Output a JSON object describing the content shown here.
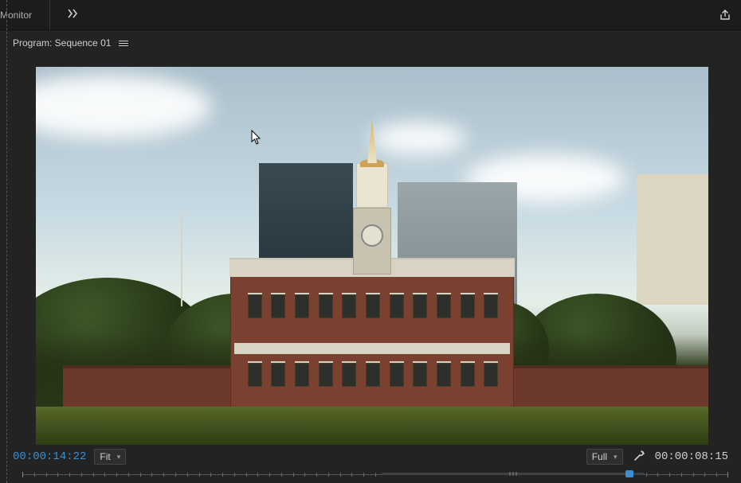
{
  "topbar": {
    "label_truncated": "Monitor"
  },
  "panel": {
    "title": "Program: Sequence 01"
  },
  "playhead": {
    "timecode": "00:00:14:22",
    "duration": "00:00:08:15",
    "zoom_label": "Fit",
    "resolution_label": "Full"
  },
  "icons": {
    "overflow": "chevrons-right",
    "export": "share-export",
    "menu": "hamburger",
    "settings": "wrench"
  }
}
